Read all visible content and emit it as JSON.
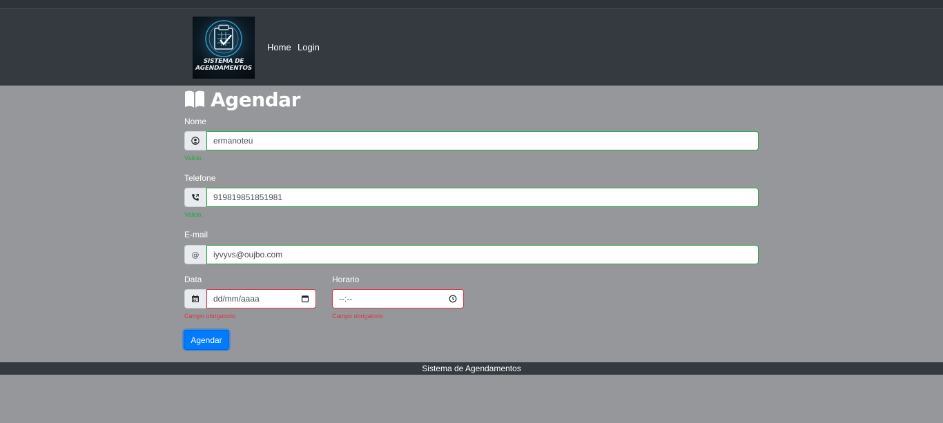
{
  "navbar": {
    "logo_text_line1": "SISTEMA DE",
    "logo_text_line2": "AGENDAMENTOS",
    "links": [
      "Home",
      "Login"
    ]
  },
  "page": {
    "title": "Agendar",
    "title_icon": "book-open-icon"
  },
  "form": {
    "nome": {
      "label": "Nome",
      "value": "ermanoteu",
      "icon": "user-circle-icon",
      "feedback": "Valido."
    },
    "telefone": {
      "label": "Telefone",
      "value": "919819851851981",
      "icon": "phone-icon",
      "feedback": "Valido."
    },
    "email": {
      "label": "E-mail",
      "value": "iyvyvs@oujbo.com",
      "icon": "@"
    },
    "data": {
      "label": "Data",
      "placeholder": "dd/mm/aaaa",
      "icon": "calendar-icon",
      "feedback": "Campo obrigatorio"
    },
    "horario": {
      "label": "Horario",
      "placeholder": "--:--",
      "icon": "clock-icon",
      "feedback": "Campo obrigatorio"
    },
    "submit_label": "Agendar"
  },
  "footer": {
    "text": "Sistema de Agendamentos"
  },
  "colors": {
    "navbar": "#343a40",
    "page_bg": "#96979a",
    "valid": "#28a745",
    "invalid": "#dc3545",
    "primary": "#007bff"
  }
}
